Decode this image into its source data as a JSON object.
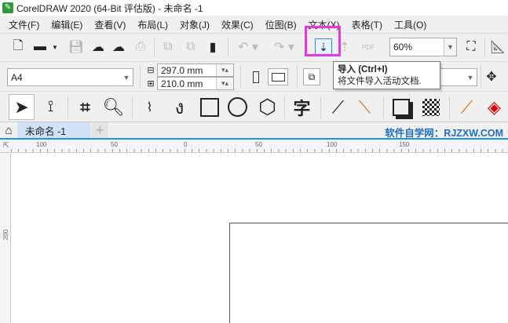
{
  "window": {
    "title": "CorelDRAW 2020 (64-Bit 评估版) - 未命名 -1"
  },
  "menu": [
    "文件(F)",
    "编辑(E)",
    "查看(V)",
    "布局(L)",
    "对象(J)",
    "效果(C)",
    "位图(B)",
    "文本(X)",
    "表格(T)",
    "工具(O)"
  ],
  "toolbar": {
    "zoom_value": "60%",
    "pdf_label": "PDF"
  },
  "property_bar": {
    "page_size": "A4",
    "width": "297.0 mm",
    "height": "210.0 mm"
  },
  "tooltip": {
    "title": "导入 (Ctrl+I)",
    "description": "将文件导入活动文档."
  },
  "tabs": {
    "doc_tab": "未命名 -1",
    "add": "+"
  },
  "watermark": "软件自学网：RJZXW.COM",
  "ruler": {
    "h_labels": [
      "100",
      "50",
      "0",
      "50",
      "100",
      "150"
    ],
    "v_labels": [
      "200"
    ]
  },
  "colors": {
    "highlight": "#e636e6",
    "tab_active": "#cfe2f8",
    "accent": "#2a8fd6"
  }
}
